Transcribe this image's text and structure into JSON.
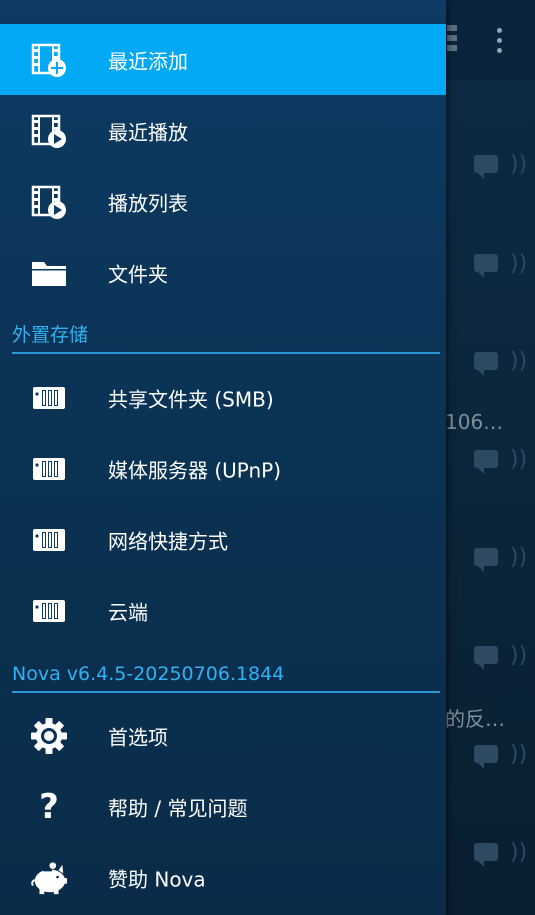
{
  "background": {
    "snippets": [
      "106…",
      "的反…"
    ]
  },
  "drawer": {
    "library_items": [
      {
        "label": "最近添加",
        "icon": "film-add-icon",
        "selected": true
      },
      {
        "label": "最近播放",
        "icon": "film-play-icon",
        "selected": false
      },
      {
        "label": "播放列表",
        "icon": "film-play-icon",
        "selected": false
      },
      {
        "label": "文件夹",
        "icon": "folder-icon",
        "selected": false
      }
    ],
    "external_header": "外置存储",
    "external_items": [
      {
        "label": "共享文件夹 (SMB)",
        "icon": "nas-icon"
      },
      {
        "label": "媒体服务器 (UPnP)",
        "icon": "nas-icon"
      },
      {
        "label": "网络快捷方式",
        "icon": "nas-icon"
      },
      {
        "label": "云端",
        "icon": "nas-icon"
      }
    ],
    "version_header": "Nova v6.4.5-20250706.1844",
    "app_items": [
      {
        "label": "首选项",
        "icon": "gear-icon"
      },
      {
        "label": "帮助 / 常见问题",
        "icon": "question-icon"
      },
      {
        "label": "赞助 Nova",
        "icon": "piggy-bank-icon"
      }
    ]
  },
  "colors": {
    "selected_bg": "#03a9f4",
    "header_text": "#2fb1f2",
    "drawer_bg": "#0d3b63"
  }
}
